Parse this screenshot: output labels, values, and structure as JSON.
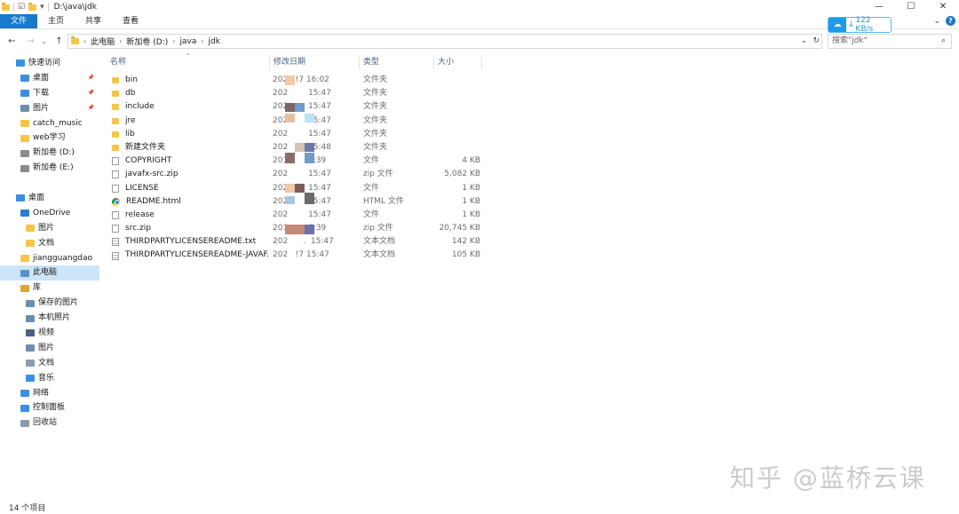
{
  "window": {
    "title": "D:\\java\\jdk",
    "controls": {
      "minimize": "—",
      "maximize": "☐",
      "close": "✕"
    }
  },
  "ribbon": {
    "tabs": [
      "文件",
      "主页",
      "共享",
      "查看"
    ],
    "help": "?"
  },
  "speed_badge": {
    "arrow": "↓",
    "value": "122 KB/s"
  },
  "address": {
    "crumbs": [
      "此电脑",
      "新加卷 (D:)",
      "java",
      "jdk"
    ],
    "search_placeholder": "搜索\"jdk\""
  },
  "sidebar": {
    "items": [
      {
        "label": "快速访问",
        "icon": "star-icon",
        "color": "#3b8ee0",
        "pinned": false,
        "selected": false,
        "indent": 0
      },
      {
        "label": "桌面",
        "icon": "desktop-icon",
        "color": "#3b8ee0",
        "pinned": true,
        "selected": false,
        "indent": 1
      },
      {
        "label": "下载",
        "icon": "download-icon",
        "color": "#3b8ee0",
        "pinned": true,
        "selected": false,
        "indent": 1
      },
      {
        "label": "图片",
        "icon": "pictures-icon",
        "color": "#6c8fb0",
        "pinned": true,
        "selected": false,
        "indent": 1
      },
      {
        "label": "catch_music",
        "icon": "folder-icon",
        "color": "#f3c54a",
        "pinned": false,
        "selected": false,
        "indent": 1
      },
      {
        "label": "web学习",
        "icon": "folder-icon",
        "color": "#f3c54a",
        "pinned": false,
        "selected": false,
        "indent": 1
      },
      {
        "label": "新加卷 (D:)",
        "icon": "drive-icon",
        "color": "#8a8a8a",
        "pinned": false,
        "selected": false,
        "indent": 1
      },
      {
        "label": "新加卷 (E:)",
        "icon": "drive-icon",
        "color": "#8a8a8a",
        "pinned": false,
        "selected": false,
        "indent": 1
      },
      {
        "label": "",
        "icon": "",
        "color": "",
        "pinned": false,
        "selected": false,
        "indent": 0,
        "spacer": true
      },
      {
        "label": "桌面",
        "icon": "desktop-icon",
        "color": "#3b8ee0",
        "pinned": false,
        "selected": false,
        "indent": 0
      },
      {
        "label": "OneDrive",
        "icon": "onedrive-icon",
        "color": "#2b7cd3",
        "pinned": false,
        "selected": false,
        "indent": 1
      },
      {
        "label": "图片",
        "icon": "folder-icon",
        "color": "#f3c54a",
        "pinned": false,
        "selected": false,
        "indent": 2
      },
      {
        "label": "文档",
        "icon": "folder-icon",
        "color": "#f3c54a",
        "pinned": false,
        "selected": false,
        "indent": 2
      },
      {
        "label": "jiangguangdao",
        "icon": "user-folder-icon",
        "color": "#f3c54a",
        "pinned": false,
        "selected": false,
        "indent": 1
      },
      {
        "label": "此电脑",
        "icon": "computer-icon",
        "color": "#5a8fc9",
        "pinned": false,
        "selected": true,
        "indent": 1
      },
      {
        "label": "库",
        "icon": "library-icon",
        "color": "#e0a23a",
        "pinned": false,
        "selected": false,
        "indent": 1
      },
      {
        "label": "保存的图片",
        "icon": "pictures-icon",
        "color": "#6c8fb0",
        "pinned": false,
        "selected": false,
        "indent": 2
      },
      {
        "label": "本机照片",
        "icon": "pictures-icon",
        "color": "#6c8fb0",
        "pinned": false,
        "selected": false,
        "indent": 2
      },
      {
        "label": "视频",
        "icon": "video-icon",
        "color": "#4a5f80",
        "pinned": false,
        "selected": false,
        "indent": 2
      },
      {
        "label": "图片",
        "icon": "pictures-icon",
        "color": "#6c8fb0",
        "pinned": false,
        "selected": false,
        "indent": 2
      },
      {
        "label": "文档",
        "icon": "document-icon",
        "color": "#8c9bb0",
        "pinned": false,
        "selected": false,
        "indent": 2
      },
      {
        "label": "音乐",
        "icon": "music-icon",
        "color": "#3b8ee0",
        "pinned": false,
        "selected": false,
        "indent": 2
      },
      {
        "label": "网络",
        "icon": "network-icon",
        "color": "#3b8ee0",
        "pinned": false,
        "selected": false,
        "indent": 1
      },
      {
        "label": "控制面板",
        "icon": "control-panel-icon",
        "color": "#3b8ee0",
        "pinned": false,
        "selected": false,
        "indent": 1
      },
      {
        "label": "回收站",
        "icon": "recycle-bin-icon",
        "color": "#8a9bb0",
        "pinned": false,
        "selected": false,
        "indent": 1
      }
    ]
  },
  "table": {
    "columns": [
      "名称",
      "修改日期",
      "类型",
      "大小"
    ],
    "rows": [
      {
        "name": "bin",
        "kind": "folder",
        "date": "202   !7 16:02",
        "type": "文件夹",
        "size": ""
      },
      {
        "name": "db",
        "kind": "folder",
        "date": "202        15:47",
        "type": "文件夹",
        "size": ""
      },
      {
        "name": "include",
        "kind": "folder",
        "date": "202        15:47",
        "type": "文件夹",
        "size": ""
      },
      {
        "name": "jre",
        "kind": "folder",
        "date": "202        15:47",
        "type": "文件夹",
        "size": ""
      },
      {
        "name": "lib",
        "kind": "folder",
        "date": "202        15:47",
        "type": "文件夹",
        "size": ""
      },
      {
        "name": "新建文件夹",
        "kind": "folder",
        "date": "202        15:48",
        "type": "文件夹",
        "size": ""
      },
      {
        "name": "COPYRIGHT",
        "kind": "file",
        "date": "201        6:39",
        "type": "文件",
        "size": "4 KB"
      },
      {
        "name": "javafx-src.zip",
        "kind": "file",
        "date": "202        15:47",
        "type": "zip 文件",
        "size": "5,082 KB"
      },
      {
        "name": "LICENSE",
        "kind": "file",
        "date": "202        15:47",
        "type": "文件",
        "size": "1 KB"
      },
      {
        "name": "README.html",
        "kind": "chrome",
        "date": "202        15:47",
        "type": "HTML 文件",
        "size": "1 KB"
      },
      {
        "name": "release",
        "kind": "file",
        "date": "202        15:47",
        "type": "文件",
        "size": "1 KB"
      },
      {
        "name": "src.zip",
        "kind": "file",
        "date": "201        6:39",
        "type": "zip 文件",
        "size": "20,745 KB"
      },
      {
        "name": "THIRDPARTYLICENSEREADME.txt",
        "kind": "txt",
        "date": "202      .  15:47",
        "type": "文本文档",
        "size": "142 KB"
      },
      {
        "name": "THIRDPARTYLICENSEREADME-JAVAF...",
        "kind": "txt",
        "date": "202   !7 15:47",
        "type": "文本文档",
        "size": "105 KB"
      }
    ]
  },
  "status": {
    "count": "14 个项目"
  },
  "watermark": "知乎 @蓝桥云课"
}
